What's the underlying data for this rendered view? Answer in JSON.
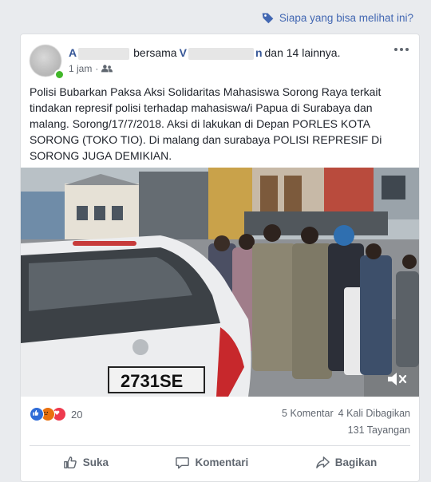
{
  "privacy": {
    "label": "Siapa yang bisa melihat ini?",
    "icon": "tag-icon"
  },
  "post": {
    "author_prefix": "A",
    "with_word": "bersama",
    "tagged_prefix": "V",
    "tagged_suffix": "n",
    "others": "dan 14 lainnya.",
    "time": "1 jam",
    "audience_icon": "friends-icon",
    "text_lines": [
      "Polisi Bubarkan Paksa Aksi Solidaritas Mahasiswa Sorong Raya terkait",
      "tindakan represif polisi terhadap mahasiswa/i Papua di Surabaya dan",
      "malang. Sorong/17/7/2018. Aksi di lakukan di Depan PORLES KOTA",
      "SORONG (TOKO TIO). Di malang dan surabaya POLISI REPRESIF Di",
      "SORONG JUGA DEMIKIAN."
    ],
    "video_plate": "2731SE"
  },
  "stats": {
    "reactions_count": "20",
    "comments": "5 Komentar",
    "shares": "4 Kali Dibagikan",
    "views": "131 Tayangan"
  },
  "actions": {
    "like": "Suka",
    "comment": "Komentari",
    "share": "Bagikan"
  },
  "colors": {
    "link": "#4267b2",
    "author": "#385898",
    "online": "#42b72a",
    "background": "#e9ebee"
  }
}
